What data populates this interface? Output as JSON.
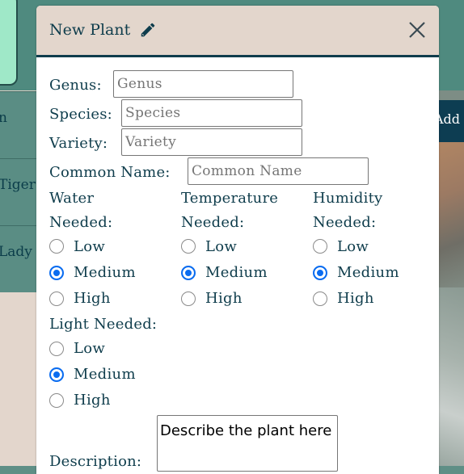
{
  "background": {
    "rows": [
      "n",
      "Tiger",
      "Lady"
    ],
    "add_button": "Add"
  },
  "modal": {
    "title": "New Plant",
    "title_icon": "pencil-icon",
    "close_icon": "close-icon",
    "fields": {
      "genus": {
        "label": "Genus:",
        "placeholder": "Genus",
        "value": ""
      },
      "species": {
        "label": "Species:",
        "placeholder": "Species",
        "value": ""
      },
      "variety": {
        "label": "Variety:",
        "placeholder": "Variety",
        "value": ""
      },
      "common_name": {
        "label": "Common Name:",
        "placeholder": "Common Name",
        "value": ""
      }
    },
    "groups": {
      "water": {
        "label_line1": "Water",
        "label_line2": "Needed:",
        "options": [
          "Low",
          "Medium",
          "High"
        ],
        "selected": "Medium"
      },
      "temperature": {
        "label_line1": "Temperature",
        "label_line2": "Needed:",
        "options": [
          "Low",
          "Medium",
          "High"
        ],
        "selected": "Medium"
      },
      "humidity": {
        "label_line1": "Humidity",
        "label_line2": "Needed:",
        "options": [
          "Low",
          "Medium",
          "High"
        ],
        "selected": "Medium"
      },
      "light": {
        "label": "Light Needed:",
        "options": [
          "Low",
          "Medium",
          "High"
        ],
        "selected": "Medium"
      }
    },
    "description": {
      "label": "Description:",
      "value": "Describe the plant here"
    }
  },
  "colors": {
    "header_bg": "#e3d6cc",
    "text": "#0f3d4c",
    "radio_selected": "#0a6cf0",
    "page_bg": "#4f8a7f"
  }
}
